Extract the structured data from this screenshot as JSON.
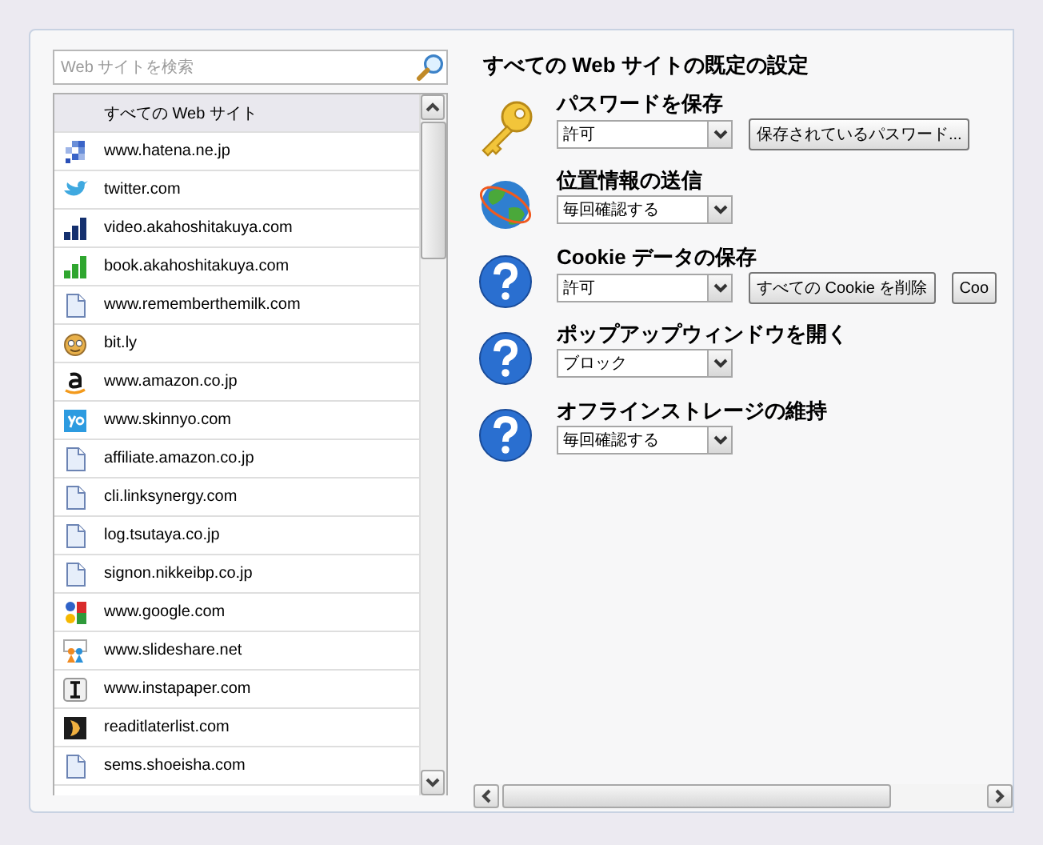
{
  "search": {
    "placeholder": "Web サイトを検索"
  },
  "sites_header": "すべての Web サイト",
  "sites": [
    {
      "name": "www.hatena.ne.jp",
      "kind": "squares"
    },
    {
      "name": "twitter.com",
      "kind": "bird"
    },
    {
      "name": "video.akahoshitakuya.com",
      "kind": "navybars"
    },
    {
      "name": "book.akahoshitakuya.com",
      "kind": "greenbars"
    },
    {
      "name": "www.rememberthemilk.com",
      "kind": "page"
    },
    {
      "name": "bit.ly",
      "kind": "face"
    },
    {
      "name": "www.amazon.co.jp",
      "kind": "letter"
    },
    {
      "name": "www.skinnyo.com",
      "kind": "tile"
    },
    {
      "name": "affiliate.amazon.co.jp",
      "kind": "page"
    },
    {
      "name": "cli.linksynergy.com",
      "kind": "page"
    },
    {
      "name": "log.tsutaya.co.jp",
      "kind": "page"
    },
    {
      "name": "signon.nikkeibp.co.jp",
      "kind": "page"
    },
    {
      "name": "www.google.com",
      "kind": "quad"
    },
    {
      "name": "www.slideshare.net",
      "kind": "people"
    },
    {
      "name": "www.instapaper.com",
      "kind": "ibeam"
    },
    {
      "name": "readitlaterlist.com",
      "kind": "chevron"
    },
    {
      "name": "sems.shoeisha.com",
      "kind": "page"
    }
  ],
  "title": "すべての Web サイトの既定の設定",
  "settings": [
    {
      "label": "パスワードを保存",
      "kind": "key",
      "value": "許可",
      "buttons": [
        "保存されているパスワード..."
      ]
    },
    {
      "label": "位置情報の送信",
      "kind": "globe",
      "value": "毎回確認する"
    },
    {
      "label": "Cookie データの保存",
      "kind": "question",
      "value": "許可",
      "buttons": [
        "すべての Cookie を削除",
        "Coo"
      ]
    },
    {
      "label": "ポップアップウィンドウを開く",
      "kind": "question",
      "value": "ブロック"
    },
    {
      "label": "オフラインストレージの維持",
      "kind": "question",
      "value": "毎回確認する"
    }
  ]
}
